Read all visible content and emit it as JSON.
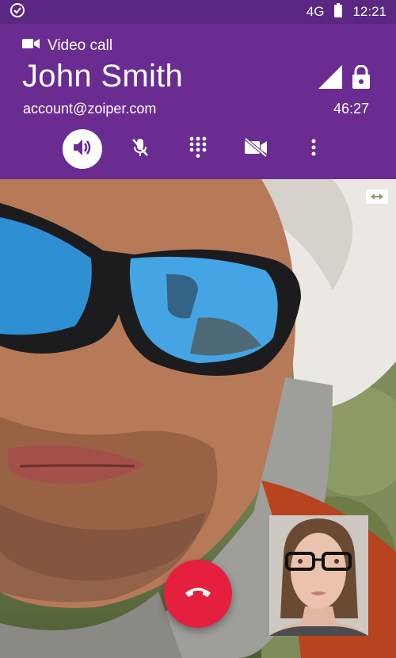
{
  "status_bar": {
    "notification_icon": "check-circle-icon",
    "network_type": "4G",
    "battery_icon": "battery-icon",
    "time": "12:21"
  },
  "call": {
    "call_type_icon": "videocam-icon",
    "call_type_label": "Video call",
    "contact_name": "John Smith",
    "account": "account@zoiper.com",
    "duration": "46:27",
    "signal_icon": "signal-icon",
    "lock_icon": "lock-icon"
  },
  "controls": [
    {
      "name": "speaker",
      "icon": "speaker-icon",
      "active": true
    },
    {
      "name": "mute",
      "icon": "mic-off-icon",
      "active": false
    },
    {
      "name": "dialpad",
      "icon": "dialpad-icon",
      "active": false
    },
    {
      "name": "video-off",
      "icon": "videocam-off-icon",
      "active": false
    },
    {
      "name": "more",
      "icon": "more-vert-icon",
      "active": false
    }
  ],
  "video": {
    "switch_camera_icon": "switch-camera-icon",
    "hangup_icon": "call-end-icon"
  },
  "colors": {
    "status_bar": "#5b2782",
    "header": "#6a2c91",
    "hangup": "#e5203f",
    "text": "#ffffff"
  }
}
